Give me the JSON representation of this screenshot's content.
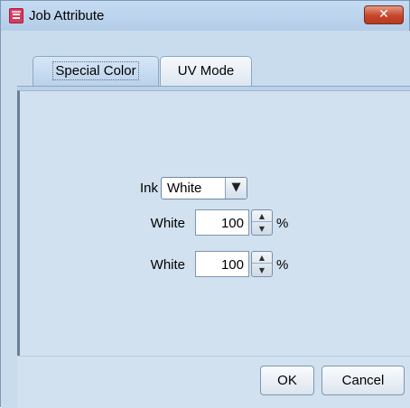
{
  "window": {
    "title": "Job Attribute",
    "close_glyph": "✕"
  },
  "icons": {
    "app": "job-app-icon",
    "close": "close-icon",
    "dropdown": "chevron-down-icon",
    "spin_up": "spin-up-icon",
    "spin_down": "spin-down-icon"
  },
  "tabs": [
    {
      "label": "Special Color",
      "active": true
    },
    {
      "label": "UV Mode",
      "active": false
    }
  ],
  "special_color": {
    "ink_label": "Ink",
    "ink_value": "White",
    "rows": [
      {
        "label": "White",
        "value": "100",
        "unit": "%"
      },
      {
        "label": "White",
        "value": "100",
        "unit": "%"
      }
    ]
  },
  "buttons": {
    "ok": "OK",
    "cancel": "Cancel"
  },
  "glyphs": {
    "dropdown_arrow": "▼",
    "spin_up": "▲",
    "spin_down": "▼"
  },
  "colors": {
    "accent": "#c9dcee",
    "close": "#c7452c",
    "app_icon": "#d93a5d"
  }
}
